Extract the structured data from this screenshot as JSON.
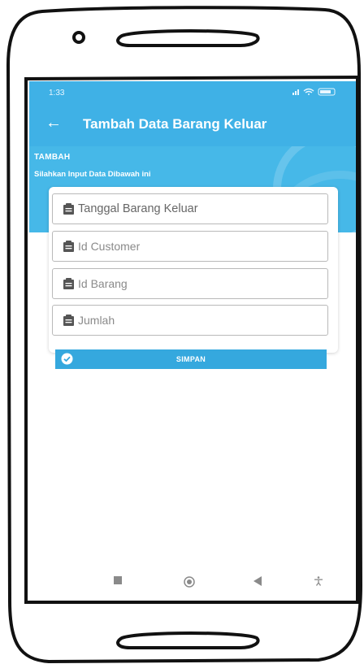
{
  "status_bar": {
    "time": "1:33",
    "signal_icons": "signal-wifi-battery"
  },
  "app_bar": {
    "back_icon": "arrow-left-icon",
    "title": "Tambah Data Barang Keluar"
  },
  "header": {
    "heading": "TAMBAH",
    "subheading": "Silahkan Input Data Dibawah ini"
  },
  "form": {
    "fields": [
      {
        "placeholder": "Tanggal Barang Keluar",
        "icon": "clipboard-icon"
      },
      {
        "placeholder": "Id Customer",
        "icon": "clipboard-icon"
      },
      {
        "placeholder": "Id Barang",
        "icon": "clipboard-icon"
      },
      {
        "placeholder": "Jumlah",
        "icon": "clipboard-icon"
      }
    ],
    "submit_label": "SIMPAN",
    "submit_icon": "check-circle-icon"
  },
  "nav_bar": {
    "items": [
      "square-icon",
      "home-circle-icon",
      "back-triangle-icon",
      "accessibility-icon"
    ]
  },
  "colors": {
    "primary": "#3fb1e6",
    "button": "#35a8de"
  }
}
